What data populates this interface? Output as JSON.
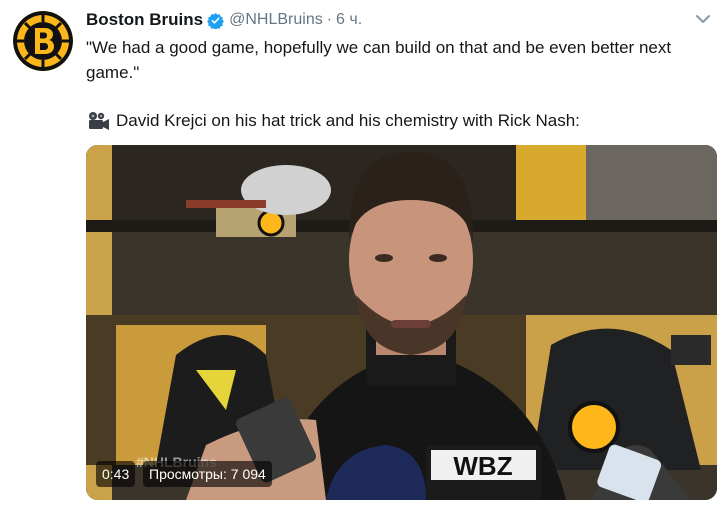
{
  "tweet": {
    "display_name": "Boston Bruins",
    "handle": "@NHLBruins",
    "separator": "·",
    "time": "6 ч.",
    "text": "\"We had a good game, hopefully we can build on that and be even better next game.\"",
    "caption": "David Krejci on his hat trick and his chemistry with Rick Nash:",
    "video": {
      "duration": "0:43",
      "views": "Просмотры: 7 094",
      "watermark": "#NHLBruins",
      "mic_label": "WBZ"
    }
  },
  "icons": {
    "avatar": "bruins-logo-icon",
    "verified": "verified-badge-icon",
    "caret": "chevron-down-icon",
    "camera": "movie-camera-icon"
  },
  "colors": {
    "bruins_gold": "#fdb71a",
    "verified_blue": "#1da1f2",
    "secondary_text": "#657786"
  }
}
